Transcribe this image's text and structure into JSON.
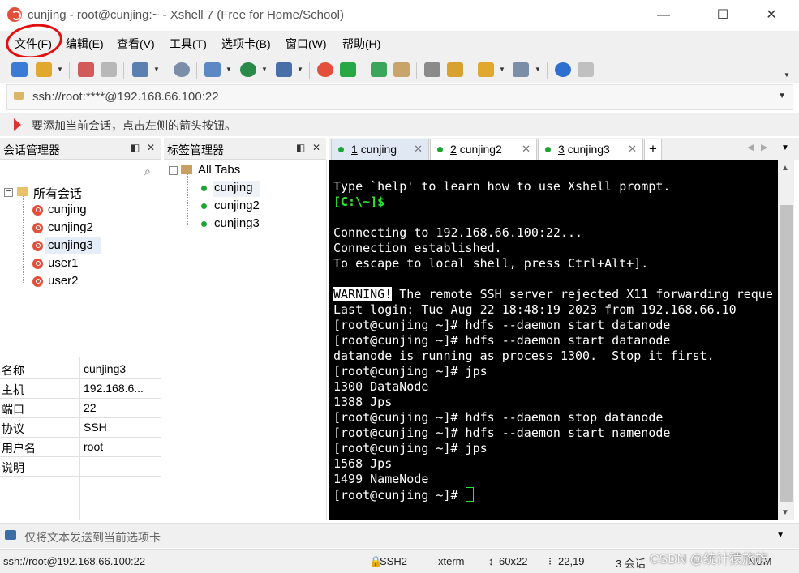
{
  "window": {
    "title": "cunjing - root@cunjing:~ - Xshell 7 (Free for Home/School)",
    "minimize": "—",
    "maximize": "☐",
    "close": "✕"
  },
  "menu": [
    "文件(F)",
    "编辑(E)",
    "查看(V)",
    "工具(T)",
    "选项卡(B)",
    "窗口(W)",
    "帮助(H)"
  ],
  "address": {
    "value": "ssh://root:****@192.168.66.100:22"
  },
  "hint": {
    "text": "要添加当前会话，点击左侧的箭头按钮。"
  },
  "session_manager": {
    "title": "会话管理器",
    "root": "所有会话",
    "sessions": [
      "cunjing",
      "cunjing2",
      "cunjing3",
      "user1",
      "user2"
    ],
    "selected": "cunjing3"
  },
  "properties": [
    {
      "key": "名称",
      "value": "cunjing3"
    },
    {
      "key": "主机",
      "value": "192.168.6..."
    },
    {
      "key": "端口",
      "value": "22"
    },
    {
      "key": "协议",
      "value": "SSH"
    },
    {
      "key": "用户名",
      "value": "root"
    },
    {
      "key": "说明",
      "value": ""
    }
  ],
  "tab_manager": {
    "title": "标签管理器",
    "root": "All Tabs",
    "tabs": [
      "cunjing",
      "cunjing2",
      "cunjing3"
    ]
  },
  "tabs": [
    {
      "number": "1",
      "label": "cunjing"
    },
    {
      "number": "2",
      "label": "cunjing2"
    },
    {
      "number": "3",
      "label": "cunjing3"
    }
  ],
  "terminal": {
    "help_line": "Type `help' to learn how to use Xshell prompt.",
    "local_prompt": "[C:\\~]$",
    "connecting": "Connecting to 192.168.66.100:22...",
    "established": "Connection established.",
    "escape": "To escape to local shell, press Ctrl+Alt+].",
    "warning_label": "WARNING!",
    "warning_text": " The remote SSH server rejected X11 forwarding reque",
    "lines": [
      "Last login: Tue Aug 22 18:48:19 2023 from 192.168.66.10",
      "[root@cunjing ~]# hdfs --daemon start datanode",
      "[root@cunjing ~]# hdfs --daemon start datanode",
      "datanode is running as process 1300.  Stop it first.",
      "[root@cunjing ~]# jps",
      "1300 DataNode",
      "1388 Jps",
      "[root@cunjing ~]# hdfs --daemon stop datanode",
      "[root@cunjing ~]# hdfs --daemon start namenode",
      "[root@cunjing ~]# jps",
      "1568 Jps",
      "1499 NameNode"
    ],
    "prompt": "[root@cunjing ~]# "
  },
  "send_bar": {
    "text": "仅将文本发送到当前选项卡"
  },
  "status": {
    "connection": "ssh://root@192.168.66.100:22",
    "protocol": "SSH2",
    "term": "xterm",
    "size": "60x22",
    "position": "22,19",
    "sessions": "3 会话",
    "num": "NUM"
  },
  "watermark": "CSDN @统计猿旅族"
}
